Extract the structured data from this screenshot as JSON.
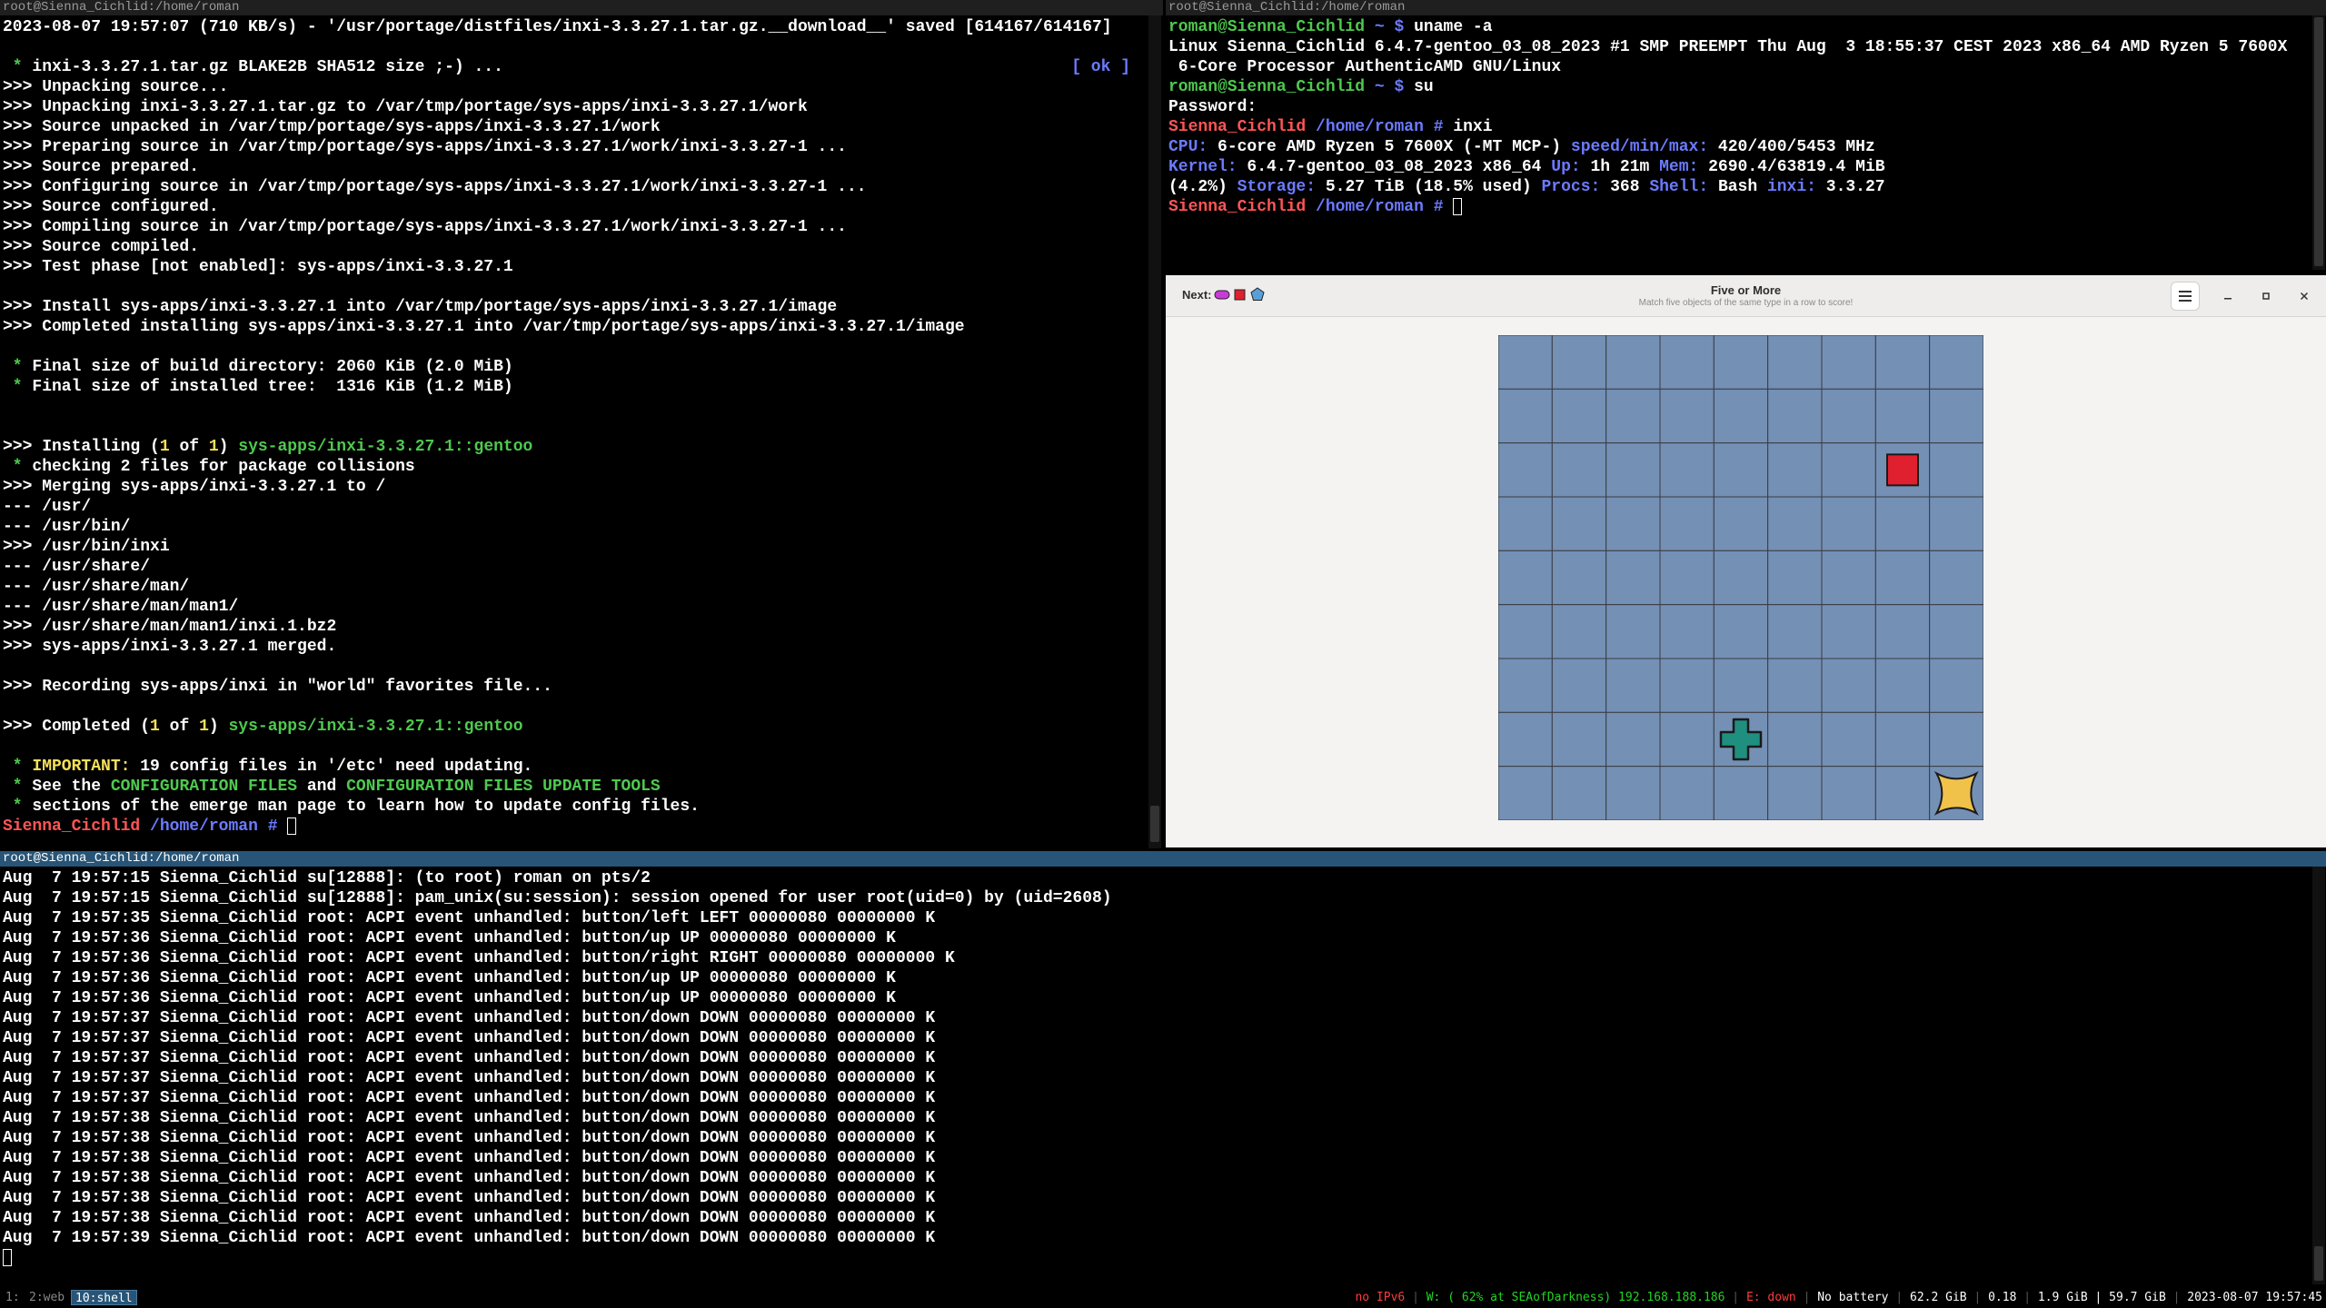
{
  "windows": {
    "top_left_title": "root@Sienna_Cichlid:/home/roman",
    "top_right_title": "root@Sienna_Cichlid:/home/roman",
    "bottom_title": "root@Sienna_Cichlid:/home/roman"
  },
  "emerge_log": [
    {
      "text": "2023-08-07 19:57:07 (710 KB/s) - '/usr/portage/distfiles/inxi-3.3.27.1.tar.gz.__download__' saved [614167/614167]"
    },
    {
      "text": ""
    },
    {
      "bullet": " * ",
      "text": "inxi-3.3.27.1.tar.gz BLAKE2B SHA512 size ;-) ...",
      "ok": "[ ok ]"
    },
    {
      "text": ">>> Unpacking source..."
    },
    {
      "text": ">>> Unpacking inxi-3.3.27.1.tar.gz to /var/tmp/portage/sys-apps/inxi-3.3.27.1/work"
    },
    {
      "text": ">>> Source unpacked in /var/tmp/portage/sys-apps/inxi-3.3.27.1/work"
    },
    {
      "text": ">>> Preparing source in /var/tmp/portage/sys-apps/inxi-3.3.27.1/work/inxi-3.3.27-1 ..."
    },
    {
      "text": ">>> Source prepared."
    },
    {
      "text": ">>> Configuring source in /var/tmp/portage/sys-apps/inxi-3.3.27.1/work/inxi-3.3.27-1 ..."
    },
    {
      "text": ">>> Source configured."
    },
    {
      "text": ">>> Compiling source in /var/tmp/portage/sys-apps/inxi-3.3.27.1/work/inxi-3.3.27-1 ..."
    },
    {
      "text": ">>> Source compiled."
    },
    {
      "text": ">>> Test phase [not enabled]: sys-apps/inxi-3.3.27.1"
    },
    {
      "text": ""
    },
    {
      "text": ">>> Install sys-apps/inxi-3.3.27.1 into /var/tmp/portage/sys-apps/inxi-3.3.27.1/image"
    },
    {
      "text": ">>> Completed installing sys-apps/inxi-3.3.27.1 into /var/tmp/portage/sys-apps/inxi-3.3.27.1/image"
    },
    {
      "text": ""
    },
    {
      "bullet": " * ",
      "text": "Final size of build directory: 2060 KiB (2.0 MiB)"
    },
    {
      "bullet": " * ",
      "text": "Final size of installed tree:  1316 KiB (1.2 MiB)"
    },
    {
      "text": ""
    },
    {
      "text": ""
    },
    {
      "pre": ">>> Installing (",
      "n1": "1",
      "mid": " of ",
      "n2": "1",
      "post": ") ",
      "pkg": "sys-apps/inxi-3.3.27.1::gentoo"
    },
    {
      "bullet": " * ",
      "text": "checking 2 files for package collisions"
    },
    {
      "text": ">>> Merging sys-apps/inxi-3.3.27.1 to /"
    },
    {
      "text": "--- /usr/"
    },
    {
      "text": "--- /usr/bin/"
    },
    {
      "text": ">>> /usr/bin/inxi"
    },
    {
      "text": "--- /usr/share/"
    },
    {
      "text": "--- /usr/share/man/"
    },
    {
      "text": "--- /usr/share/man/man1/"
    },
    {
      "text": ">>> /usr/share/man/man1/inxi.1.bz2"
    },
    {
      "text": ">>> sys-apps/inxi-3.3.27.1 merged."
    },
    {
      "text": ""
    },
    {
      "text": ">>> Recording sys-apps/inxi in \"world\" favorites file..."
    },
    {
      "text": ""
    },
    {
      "pre": ">>> Completed (",
      "n1": "1",
      "mid": " of ",
      "n2": "1",
      "post": ") ",
      "pkg": "sys-apps/inxi-3.3.27.1::gentoo"
    },
    {
      "text": ""
    },
    {
      "bullet": " * ",
      "label": "IMPORTANT:",
      "text": " 19 config files in '/etc' need updating."
    },
    {
      "bullet": " * ",
      "pre": "See the ",
      "hl1": "CONFIGURATION FILES",
      "mid": " and ",
      "hl2": "CONFIGURATION FILES UPDATE TOOLS"
    },
    {
      "bullet": " * ",
      "text": "sections of the emerge man page to learn how to update config files."
    }
  ],
  "root_prompt": {
    "host": "Sienna_Cichlid",
    "path": "/home/roman",
    "symbol": "#"
  },
  "inxi_terminal": {
    "user_prompt": {
      "user": "roman@Sienna_Cichlid",
      "path": "~",
      "symbol": "$"
    },
    "cmd1": "uname -a",
    "uname_line1": "Linux Sienna_Cichlid 6.4.7-gentoo_03_08_2023 #1 SMP PREEMPT Thu Aug  3 18:55:37 CEST 2023 x86_64 AMD Ryzen 5 7600X",
    "uname_line2": " 6-Core Processor AuthenticAMD GNU/Linux",
    "cmd2": "su",
    "password_label": "Password:",
    "cmd3": "inxi",
    "inxi": {
      "cpu_label": "CPU:",
      "cpu_value": " 6-core AMD Ryzen 5 7600X (-MT MCP-) ",
      "speed_label": "speed/min/max:",
      "speed_value": " 420/400/5453 MHz",
      "kernel_label": "Kernel:",
      "kernel_value": " 6.4.7-gentoo_03_08_2023 x86_64 ",
      "up_label": "Up:",
      "up_value": " 1h 21m ",
      "mem_label": "Mem:",
      "mem_value": " 2690.4/63819.4 MiB",
      "mem_pct": "(4.2%) ",
      "storage_label": "Storage:",
      "storage_value": " 5.27 TiB (18.5% used) ",
      "procs_label": "Procs:",
      "procs_value": " 368 ",
      "shell_label": "Shell:",
      "shell_value": " Bash ",
      "inxi_label": "inxi:",
      "inxi_value": " 3.3.27"
    }
  },
  "game": {
    "next_label": "Next:",
    "next_pieces": [
      {
        "shape": "pill",
        "color": "#c83bd8",
        "icon": "magenta-pill-icon"
      },
      {
        "shape": "square",
        "color": "#e0202f",
        "icon": "red-square-icon"
      },
      {
        "shape": "pentagon",
        "color": "#5aa0d8",
        "icon": "blue-pentagon-icon"
      }
    ],
    "title": "Five or More",
    "subtitle": "Match five objects of the same type in a row to score!",
    "board_size": 9,
    "board_color": "#7490b5",
    "grid_color": "#3a3d44",
    "pieces": [
      {
        "row": 2,
        "col": 7,
        "shape": "square",
        "color": "#e0202f",
        "icon": "red-square-icon"
      },
      {
        "row": 7,
        "col": 4,
        "shape": "cross",
        "color": "#1f8f80",
        "icon": "teal-cross-icon"
      },
      {
        "row": 8,
        "col": 8,
        "shape": "star",
        "color": "#f0c24a",
        "icon": "yellow-star-icon"
      }
    ]
  },
  "syslog": [
    "Aug  7 19:57:15 Sienna_Cichlid su[12888]: (to root) roman on pts/2",
    "Aug  7 19:57:15 Sienna_Cichlid su[12888]: pam_unix(su:session): session opened for user root(uid=0) by (uid=2608)",
    "Aug  7 19:57:35 Sienna_Cichlid root: ACPI event unhandled: button/left LEFT 00000080 00000000 K",
    "Aug  7 19:57:36 Sienna_Cichlid root: ACPI event unhandled: button/up UP 00000080 00000000 K",
    "Aug  7 19:57:36 Sienna_Cichlid root: ACPI event unhandled: button/right RIGHT 00000080 00000000 K",
    "Aug  7 19:57:36 Sienna_Cichlid root: ACPI event unhandled: button/up UP 00000080 00000000 K",
    "Aug  7 19:57:36 Sienna_Cichlid root: ACPI event unhandled: button/up UP 00000080 00000000 K",
    "Aug  7 19:57:37 Sienna_Cichlid root: ACPI event unhandled: button/down DOWN 00000080 00000000 K",
    "Aug  7 19:57:37 Sienna_Cichlid root: ACPI event unhandled: button/down DOWN 00000080 00000000 K",
    "Aug  7 19:57:37 Sienna_Cichlid root: ACPI event unhandled: button/down DOWN 00000080 00000000 K",
    "Aug  7 19:57:37 Sienna_Cichlid root: ACPI event unhandled: button/down DOWN 00000080 00000000 K",
    "Aug  7 19:57:37 Sienna_Cichlid root: ACPI event unhandled: button/down DOWN 00000080 00000000 K",
    "Aug  7 19:57:38 Sienna_Cichlid root: ACPI event unhandled: button/down DOWN 00000080 00000000 K",
    "Aug  7 19:57:38 Sienna_Cichlid root: ACPI event unhandled: button/down DOWN 00000080 00000000 K",
    "Aug  7 19:57:38 Sienna_Cichlid root: ACPI event unhandled: button/down DOWN 00000080 00000000 K",
    "Aug  7 19:57:38 Sienna_Cichlid root: ACPI event unhandled: button/down DOWN 00000080 00000000 K",
    "Aug  7 19:57:38 Sienna_Cichlid root: ACPI event unhandled: button/down DOWN 00000080 00000000 K",
    "Aug  7 19:57:38 Sienna_Cichlid root: ACPI event unhandled: button/down DOWN 00000080 00000000 K",
    "Aug  7 19:57:39 Sienna_Cichlid root: ACPI event unhandled: button/down DOWN 00000080 00000000 K"
  ],
  "statusbar": {
    "workspaces": [
      {
        "label": "1:",
        "active": false
      },
      {
        "label": "2:web",
        "active": false
      },
      {
        "label": "10:shell",
        "active": true
      }
    ],
    "items": [
      {
        "text": "no IPv6",
        "color": "#ff3b3b"
      },
      {
        "text": "W: ( 62% at SEAofDarkness) 192.168.188.186",
        "color": "#22d322"
      },
      {
        "text": "E: down",
        "color": "#ff3b3b"
      },
      {
        "text": "No battery",
        "color": "#ffffff"
      },
      {
        "text": "62.2 GiB",
        "color": "#ffffff"
      },
      {
        "text": "0.18",
        "color": "#ffffff"
      },
      {
        "text": "1.9 GiB | 59.7 GiB",
        "color": "#ffffff"
      },
      {
        "text": "2023-08-07 19:57:45",
        "color": "#ffffff"
      }
    ]
  }
}
